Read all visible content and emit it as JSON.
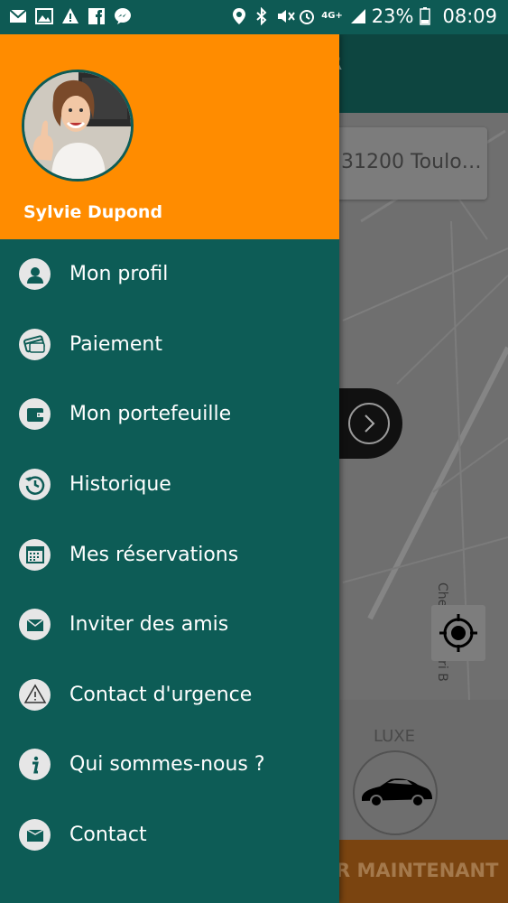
{
  "status_bar": {
    "left_icons": [
      "mail-icon",
      "image-icon",
      "warning-icon",
      "facebook-icon",
      "messenger-icon"
    ],
    "right_icons": [
      "location-icon",
      "bluetooth-icon",
      "mute-icon",
      "alarm-icon",
      "network-4g-icon",
      "signal-icon",
      "battery-icon"
    ],
    "network": "4G+",
    "battery": "23%",
    "time": "08:09"
  },
  "drawer": {
    "user_name": "Sylvie Dupond",
    "header_color": "#ff8c00",
    "background_color": "#0d5c56",
    "items": [
      {
        "label": "Mon profil",
        "icon": "user-icon"
      },
      {
        "label": "Paiement",
        "icon": "credit-card-icon"
      },
      {
        "label": "Mon portefeuille",
        "icon": "wallet-icon"
      },
      {
        "label": "Historique",
        "icon": "history-icon"
      },
      {
        "label": "Mes réservations",
        "icon": "calendar-icon"
      },
      {
        "label": "Inviter des amis",
        "icon": "envelope-icon"
      },
      {
        "label": "Contact d'urgence",
        "icon": "warning-icon"
      },
      {
        "label": "Qui sommes-nous ?",
        "icon": "info-icon"
      },
      {
        "label": "Contact",
        "icon": "mail-icon"
      }
    ]
  },
  "background": {
    "toolbar_fragment": "R",
    "address_fragment": "31200 Toulo…",
    "street_label": "Chemin Henri B",
    "vehicle_label": "LUXE",
    "cta_fragment": "R MAINTENANT"
  }
}
